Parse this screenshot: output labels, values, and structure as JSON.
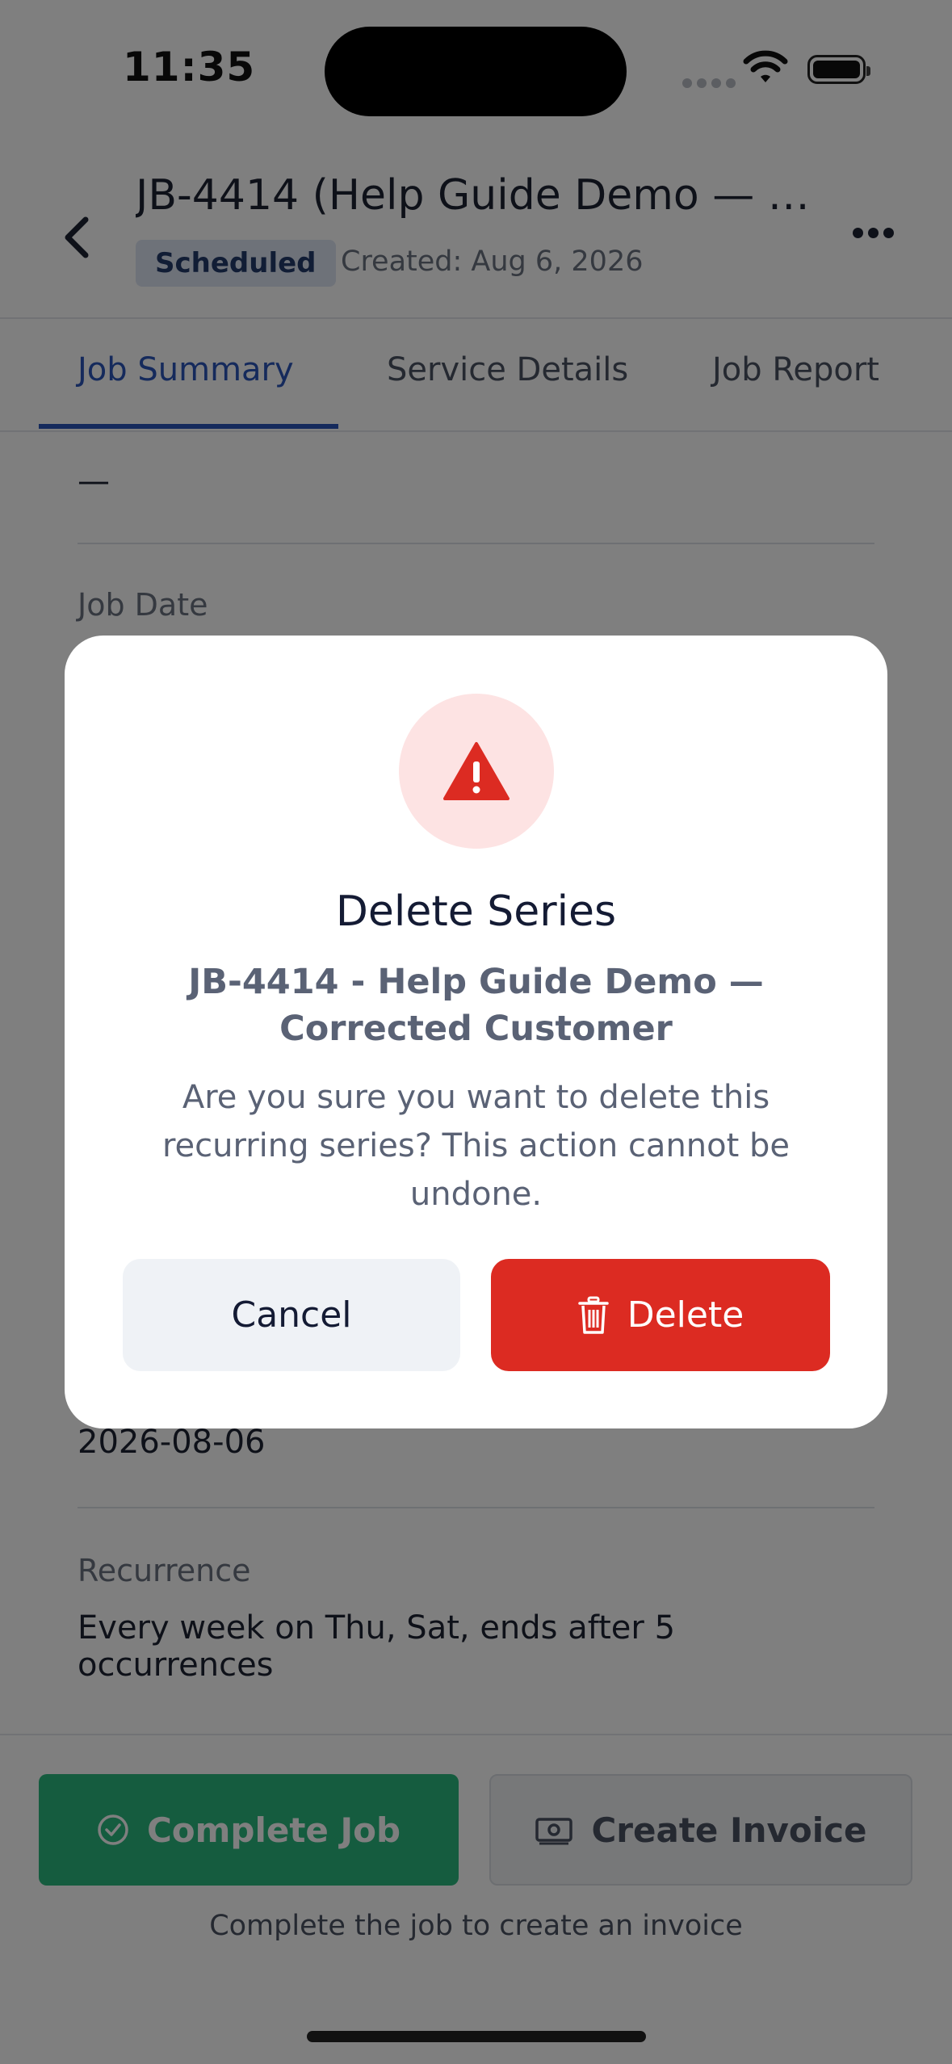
{
  "status_bar": {
    "time": "11:35"
  },
  "header": {
    "title": "JB-4414 (Help Guide Demo — Co...",
    "status": "Scheduled",
    "created": "Created: Aug 6, 2026"
  },
  "tabs": [
    {
      "label": "Job Summary",
      "active": true
    },
    {
      "label": "Service Details",
      "active": false
    },
    {
      "label": "Job Report",
      "active": false
    }
  ],
  "content": {
    "prev_value": "—",
    "job_date_label": "Job Date",
    "date_value": "2026-08-06",
    "recurrence_label": "Recurrence",
    "recurrence_value": "Every week on Thu, Sat, ends after 5 occurrences"
  },
  "footer": {
    "complete_label": "Complete Job",
    "invoice_label": "Create Invoice",
    "hint": "Complete the job to create an invoice"
  },
  "modal": {
    "title": "Delete Series",
    "subtitle": "JB-4414 - Help Guide Demo — Corrected Customer",
    "message": "Are you sure you want to delete this recurring series? This action cannot be undone.",
    "cancel_label": "Cancel",
    "delete_label": "Delete"
  },
  "colors": {
    "accent": "#2a55b8",
    "danger": "#dc2b22",
    "success": "#2ab87f"
  },
  "icons": [
    "back-chevron-icon",
    "more-icon",
    "warning-icon",
    "trash-icon",
    "check-circle-icon",
    "cash-icon",
    "wifi-icon",
    "battery-icon"
  ]
}
